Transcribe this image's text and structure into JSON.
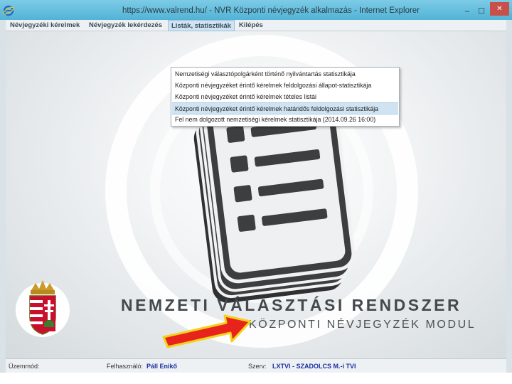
{
  "window": {
    "title": "https://www.valrend.hu/ - NVR Központi névjegyzék alkalmazás - Internet Explorer",
    "minimize_glyph": "–",
    "maximize_glyph": "☐",
    "close_glyph": "✕"
  },
  "menu": {
    "items": [
      {
        "label": "Névjegyzéki kérelmek"
      },
      {
        "label": "Névjegyzék lekérdezés"
      },
      {
        "label": "Listák, statisztikák"
      },
      {
        "label": "Kilépés"
      }
    ],
    "active_index": 2
  },
  "dropdown": {
    "items": [
      {
        "label": "Nemzetiségi választópolgárként történő nyilvántartás statisztikája"
      },
      {
        "label": "Központi névjegyzéket érintő kérelmek feldolgozási állapot-statisztikája"
      },
      {
        "label": "Központi névjegyzéket érintő kérelmek tételes listái"
      },
      {
        "label": "Központi névjegyzéket érintő kérelmek határidős feldolgozási statisztikája"
      },
      {
        "label": "Fel nem dolgozott nemzetiségi kérelmek statisztikája (2014.09.26 16:00)"
      }
    ],
    "highlighted_index": 3
  },
  "branding": {
    "line1": "NEMZETI VÁLASZTÁSI RENDSZER",
    "line2": "KÖZPONTI NÉVJEGYZÉK MODUL"
  },
  "status": {
    "mode_label": "Üzemmód:",
    "user_label": "Felhasználó:",
    "user_value": "Páll Enikő",
    "org_label": "Szerv:",
    "org_value": "LXTVI - SZADOLCS M.-i TVI"
  },
  "colors": {
    "titlebar": "#52b3d6",
    "menu_active": "#cfe3f2",
    "arrow_fill": "#e8231c",
    "arrow_outline": "#f2d21a",
    "status_value": "#1a2fa0"
  },
  "icons": {
    "browser": "internet-explorer-icon",
    "document": "document-list-icon",
    "crest": "hungarian-coat-of-arms",
    "pointer": "red-arrow"
  }
}
